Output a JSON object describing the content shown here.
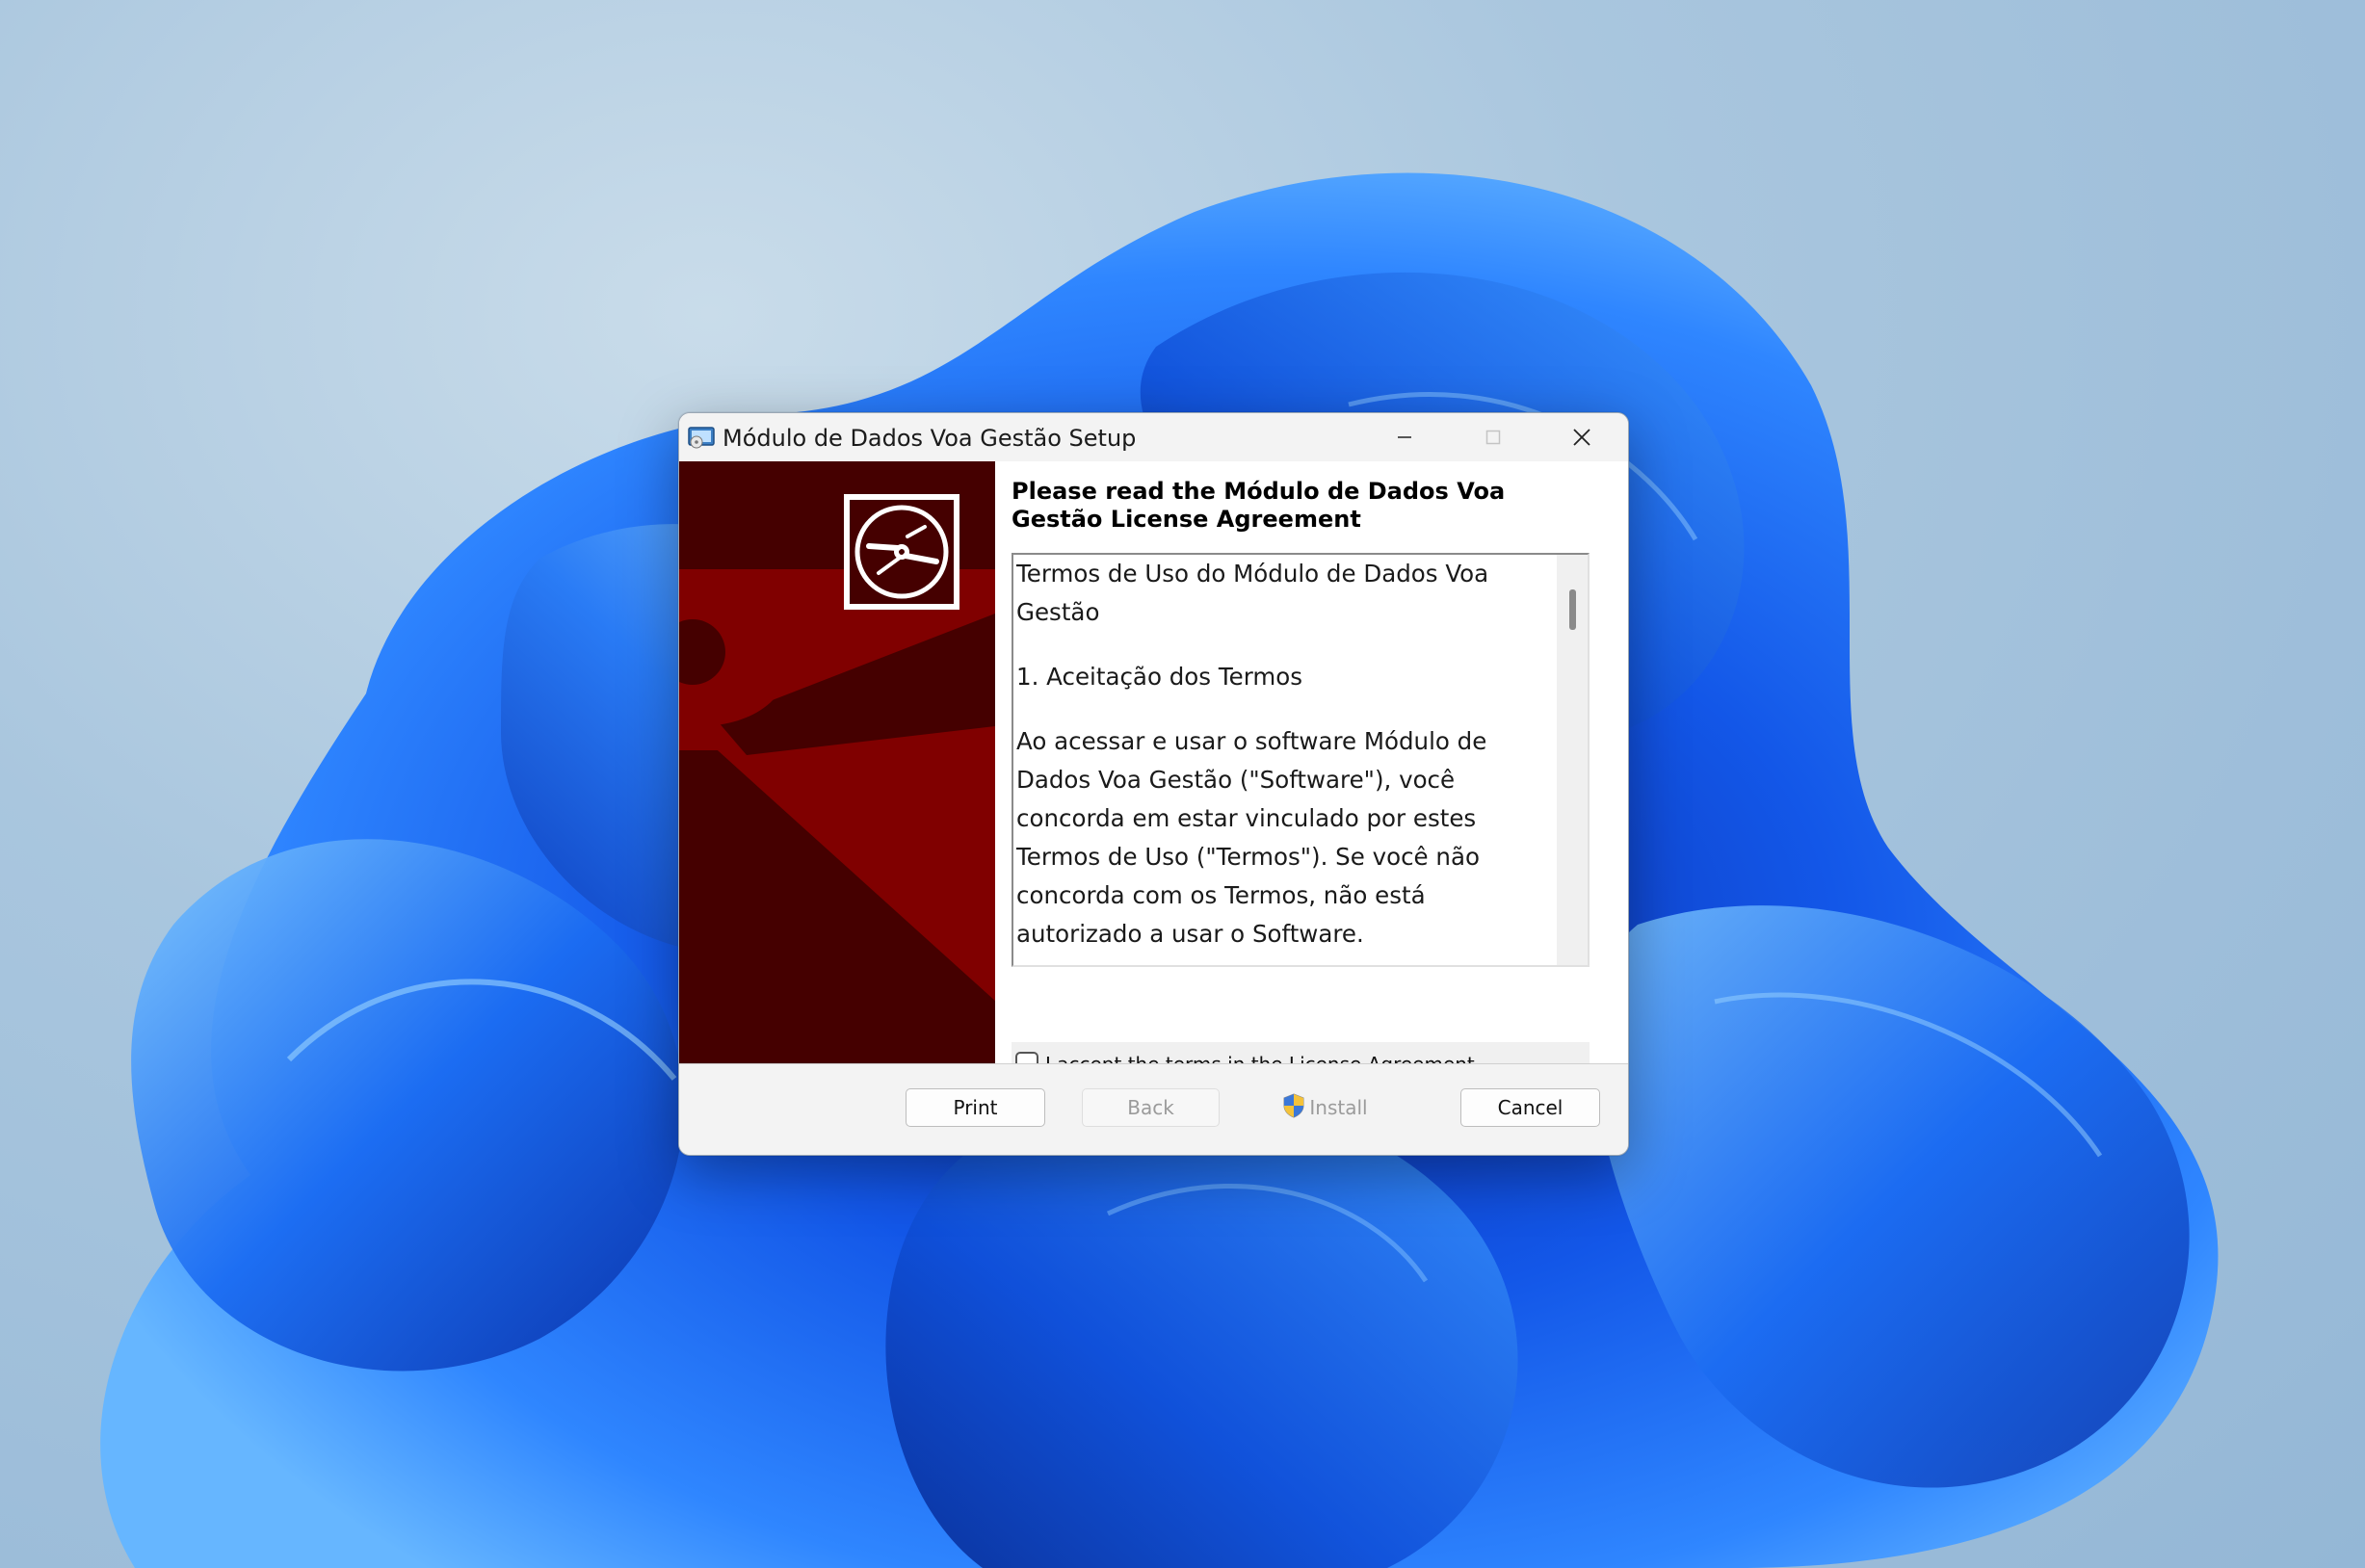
{
  "window": {
    "title": "Módulo de Dados Voa Gestão Setup",
    "icon": "installer-icon"
  },
  "caption_buttons": {
    "minimize": "minimize-icon",
    "maximize": "maximize-icon",
    "close": "close-icon"
  },
  "banner": {
    "icon": "disc-icon",
    "colors": {
      "dark": "#450000",
      "red": "#800000"
    }
  },
  "heading": "Please read the Módulo de Dados Voa Gestão License Agreement",
  "license": {
    "paragraphs": [
      "Termos de Uso do Módulo de Dados Voa Gestão",
      "1. Aceitação dos Termos",
      "Ao acessar e usar o software Módulo de Dados Voa Gestão (\"Software\"), você concorda em estar vinculado por estes Termos de Uso (\"Termos\"). Se você não concorda com os Termos, não está autorizado a usar o Software."
    ]
  },
  "accept": {
    "label": "I accept the terms in the License Agreement",
    "checked": false
  },
  "buttons": {
    "print": "Print",
    "back": "Back",
    "install": "Install",
    "cancel": "Cancel",
    "install_icon": "uac-shield-icon"
  }
}
